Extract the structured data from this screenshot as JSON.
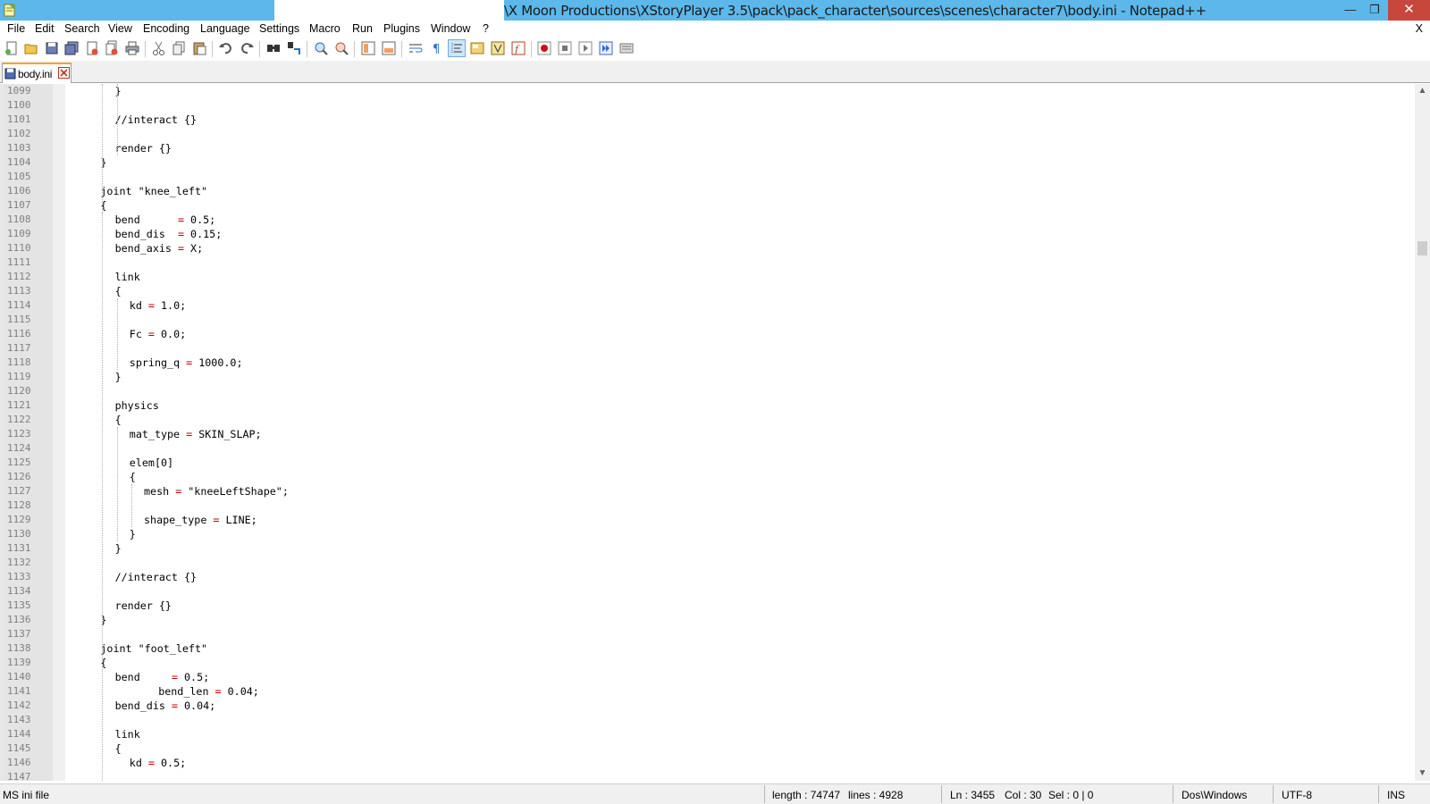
{
  "window": {
    "title": "\\X Moon Productions\\XStoryPlayer 3.5\\pack\\pack_character\\sources\\scenes\\character7\\body.ini - Notepad++",
    "minimize": "—",
    "maximize": "❐",
    "close": "✕"
  },
  "menu": {
    "items": [
      "File",
      "Edit",
      "Search",
      "View",
      "Encoding",
      "Language",
      "Settings",
      "Macro",
      "Run",
      "Plugins",
      "Window",
      "?"
    ],
    "close": "X"
  },
  "toolbar": {
    "icons": [
      "new-file-icon",
      "open-file-icon",
      "save-icon",
      "save-all-icon",
      "close-icon",
      "close-all-icon",
      "print-icon",
      "cut-icon",
      "copy-icon",
      "paste-icon",
      "undo-icon",
      "redo-icon",
      "find-icon",
      "replace-icon",
      "zoom-in-icon",
      "zoom-out-icon",
      "sync-vertical-icon",
      "sync-horizontal-icon",
      "word-wrap-icon",
      "show-all-chars-icon",
      "indent-guide-icon",
      "user-language-icon",
      "document-map-icon",
      "function-list-icon",
      "record-macro-icon",
      "stop-record-icon",
      "play-macro-icon",
      "run-macro-multiple-icon",
      "save-macro-icon"
    ]
  },
  "tab": {
    "label": "body.ini"
  },
  "editor": {
    "lines": [
      {
        "n": "1099",
        "indent": 3,
        "text": "}"
      },
      {
        "n": "1100",
        "indent": 0,
        "text": ""
      },
      {
        "n": "1101",
        "indent": 3,
        "text": "//interact {}"
      },
      {
        "n": "1102",
        "indent": 0,
        "text": ""
      },
      {
        "n": "1103",
        "indent": 3,
        "text": "render {}"
      },
      {
        "n": "1104",
        "indent": 2,
        "text": "}"
      },
      {
        "n": "1105",
        "indent": 0,
        "text": ""
      },
      {
        "n": "1106",
        "indent": 2,
        "text": "joint \"knee_left\""
      },
      {
        "n": "1107",
        "indent": 2,
        "text": "{"
      },
      {
        "n": "1108",
        "indent": 3,
        "text": "bend      = 0.5;"
      },
      {
        "n": "1109",
        "indent": 3,
        "text": "bend_dis  = 0.15;"
      },
      {
        "n": "1110",
        "indent": 3,
        "text": "bend_axis = X;"
      },
      {
        "n": "1111",
        "indent": 0,
        "text": ""
      },
      {
        "n": "1112",
        "indent": 3,
        "text": "link"
      },
      {
        "n": "1113",
        "indent": 3,
        "text": "{"
      },
      {
        "n": "1114",
        "indent": 4,
        "text": "kd = 1.0;"
      },
      {
        "n": "1115",
        "indent": 0,
        "text": ""
      },
      {
        "n": "1116",
        "indent": 4,
        "text": "Fc = 0.0;"
      },
      {
        "n": "1117",
        "indent": 0,
        "text": ""
      },
      {
        "n": "1118",
        "indent": 4,
        "text": "spring_q = 1000.0;"
      },
      {
        "n": "1119",
        "indent": 3,
        "text": "}"
      },
      {
        "n": "1120",
        "indent": 0,
        "text": ""
      },
      {
        "n": "1121",
        "indent": 3,
        "text": "physics"
      },
      {
        "n": "1122",
        "indent": 3,
        "text": "{"
      },
      {
        "n": "1123",
        "indent": 4,
        "text": "mat_type = SKIN_SLAP;"
      },
      {
        "n": "1124",
        "indent": 0,
        "text": ""
      },
      {
        "n": "1125",
        "indent": 4,
        "text": "elem[0]"
      },
      {
        "n": "1126",
        "indent": 4,
        "text": "{"
      },
      {
        "n": "1127",
        "indent": 5,
        "text": "mesh = \"kneeLeftShape\";"
      },
      {
        "n": "1128",
        "indent": 0,
        "text": ""
      },
      {
        "n": "1129",
        "indent": 5,
        "text": "shape_type = LINE;"
      },
      {
        "n": "1130",
        "indent": 4,
        "text": "}"
      },
      {
        "n": "1131",
        "indent": 3,
        "text": "}"
      },
      {
        "n": "1132",
        "indent": 0,
        "text": ""
      },
      {
        "n": "1133",
        "indent": 3,
        "text": "//interact {}"
      },
      {
        "n": "1134",
        "indent": 0,
        "text": ""
      },
      {
        "n": "1135",
        "indent": 3,
        "text": "render {}"
      },
      {
        "n": "1136",
        "indent": 2,
        "text": "}"
      },
      {
        "n": "1137",
        "indent": 0,
        "text": ""
      },
      {
        "n": "1138",
        "indent": 2,
        "text": "joint \"foot_left\""
      },
      {
        "n": "1139",
        "indent": 2,
        "text": "{"
      },
      {
        "n": "1140",
        "indent": 3,
        "text": "bend     = 0.5;"
      },
      {
        "n": "1141",
        "indent": 6,
        "text": "bend_len = 0.04;"
      },
      {
        "n": "1142",
        "indent": 3,
        "text": "bend_dis = 0.04;"
      },
      {
        "n": "1143",
        "indent": 0,
        "text": ""
      },
      {
        "n": "1144",
        "indent": 3,
        "text": "link"
      },
      {
        "n": "1145",
        "indent": 3,
        "text": "{"
      },
      {
        "n": "1146",
        "indent": 4,
        "text": "kd = 0.5;"
      },
      {
        "n": "1147",
        "indent": 0,
        "text": ""
      }
    ]
  },
  "status": {
    "file_type": "MS ini file",
    "length": "length : 74747",
    "lines": "lines : 4928",
    "ln": "Ln : 3455",
    "col": "Col : 30",
    "sel": "Sel : 0 | 0",
    "eol": "Dos\\Windows",
    "encoding": "UTF-8",
    "mode": "INS"
  },
  "colors": {
    "title_accent": "#5cb8ea",
    "tab_accent": "#f9a31e",
    "operator": "#c00000",
    "line_number": "#808080",
    "close_button": "#c7473c"
  }
}
